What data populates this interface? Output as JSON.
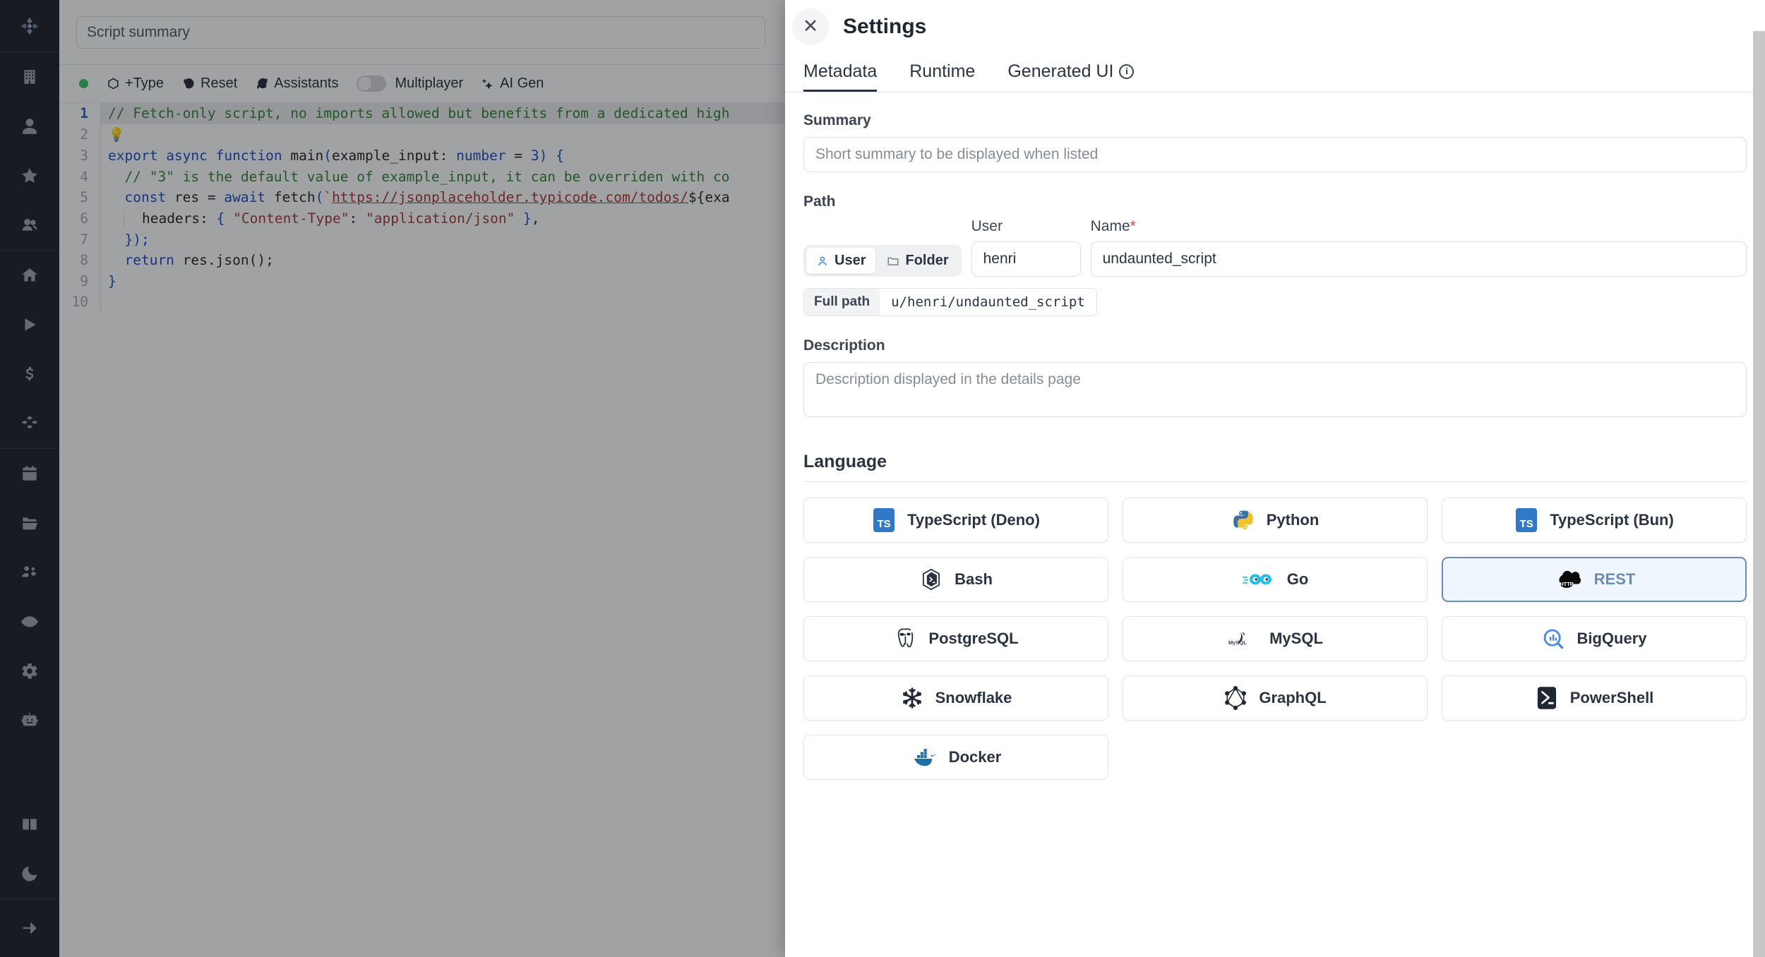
{
  "sidebar": {
    "logo": "windmill-logo",
    "items": [
      {
        "name": "building-icon"
      },
      {
        "name": "user-icon"
      },
      {
        "name": "star-icon"
      },
      {
        "name": "users-icon"
      },
      {
        "name": "home-icon"
      },
      {
        "name": "play-icon"
      },
      {
        "name": "dollar-icon"
      },
      {
        "name": "blocks-icon"
      },
      {
        "name": "calendar-icon"
      },
      {
        "name": "folder-icon"
      },
      {
        "name": "group-settings-icon"
      },
      {
        "name": "eye-icon"
      },
      {
        "name": "gear-icon"
      },
      {
        "name": "robot-icon"
      },
      {
        "name": "book-icon"
      },
      {
        "name": "moon-icon"
      },
      {
        "name": "arrow-right-icon"
      }
    ]
  },
  "topbar": {
    "summary_placeholder": "Script summary",
    "edit_icon": "pencil-icon"
  },
  "toolbar": {
    "status_dot": "#33c05e",
    "add_type_label": "+Type",
    "reset_label": "Reset",
    "assistants_label": "Assistants",
    "multiplayer_label": "Multiplayer",
    "multiplayer_enabled": false,
    "ai_gen_label": "AI Gen"
  },
  "editor": {
    "lines": [
      {
        "n": "1",
        "active": true
      },
      {
        "n": "2",
        "active": false
      },
      {
        "n": "3",
        "active": false
      },
      {
        "n": "4",
        "active": false
      },
      {
        "n": "5",
        "active": false
      },
      {
        "n": "6",
        "active": false
      },
      {
        "n": "7",
        "active": false
      },
      {
        "n": "8",
        "active": false
      },
      {
        "n": "9",
        "active": false
      },
      {
        "n": "10",
        "active": false
      }
    ],
    "code": {
      "l1": "// Fetch-only script, no imports allowed but benefits from a dedicated high",
      "l3_kw1": "export",
      "l3_kw2": "async",
      "l3_kw3": "function",
      "l3_fn": "main",
      "l3_arg": "example_input",
      "l3_type": "number",
      "l3_default": "3",
      "l4": "// \"3\" is the default value of example_input, it can be overriden with co",
      "l5_const": "const",
      "l5_res": "res",
      "l5_await": "await",
      "l5_fetch": "fetch",
      "l5_url": "https://jsonplaceholder.typicode.com/todos/",
      "l5_expr": "${exa",
      "l6_key": "headers",
      "l6_ct": "\"Content-Type\"",
      "l6_val": "\"application/json\"",
      "l7": "});",
      "l8_return": "return",
      "l8_expr": "res.json();",
      "l9": "}"
    }
  },
  "drawer": {
    "title": "Settings",
    "close_icon": "close-icon",
    "tabs": [
      {
        "label": "Metadata",
        "active": true,
        "info": false
      },
      {
        "label": "Runtime",
        "active": false,
        "info": false
      },
      {
        "label": "Generated UI",
        "active": false,
        "info": true
      }
    ],
    "summary": {
      "label": "Summary",
      "value": "",
      "placeholder": "Short summary to be displayed when listed"
    },
    "path": {
      "label": "Path",
      "segments": [
        {
          "label": "User",
          "icon": "person-icon",
          "active": true
        },
        {
          "label": "Folder",
          "icon": "folder-icon",
          "active": false
        }
      ],
      "user_label": "User",
      "user_value": "henri",
      "name_label": "Name",
      "name_required": "*",
      "name_value": "undaunted_script",
      "fullpath_label": "Full path",
      "fullpath_value": "u/henri/undaunted_script"
    },
    "description": {
      "label": "Description",
      "value": "",
      "placeholder": "Description displayed in the details page"
    },
    "language": {
      "label": "Language",
      "options": [
        {
          "label": "TypeScript (Deno)",
          "icon": "typescript-icon",
          "selected": false
        },
        {
          "label": "Python",
          "icon": "python-icon",
          "selected": false
        },
        {
          "label": "TypeScript (Bun)",
          "icon": "typescript-icon",
          "selected": false
        },
        {
          "label": "Bash",
          "icon": "bash-icon",
          "selected": false
        },
        {
          "label": "Go",
          "icon": "go-icon",
          "selected": false
        },
        {
          "label": "REST",
          "icon": "http-cloud-icon",
          "selected": true
        },
        {
          "label": "PostgreSQL",
          "icon": "postgresql-icon",
          "selected": false
        },
        {
          "label": "MySQL",
          "icon": "mysql-icon",
          "selected": false
        },
        {
          "label": "BigQuery",
          "icon": "bigquery-icon",
          "selected": false
        },
        {
          "label": "Snowflake",
          "icon": "snowflake-icon",
          "selected": false
        },
        {
          "label": "GraphQL",
          "icon": "graphql-icon",
          "selected": false
        },
        {
          "label": "PowerShell",
          "icon": "powershell-icon",
          "selected": false
        },
        {
          "label": "Docker",
          "icon": "docker-icon",
          "selected": false
        }
      ]
    }
  },
  "colors": {
    "accent": "#3178c6",
    "selected_border": "#6b8cb5",
    "selected_bg": "#eff6fd",
    "sidebar_bg": "#14181f",
    "status_green": "#33c05e",
    "required_red": "#e04343"
  }
}
